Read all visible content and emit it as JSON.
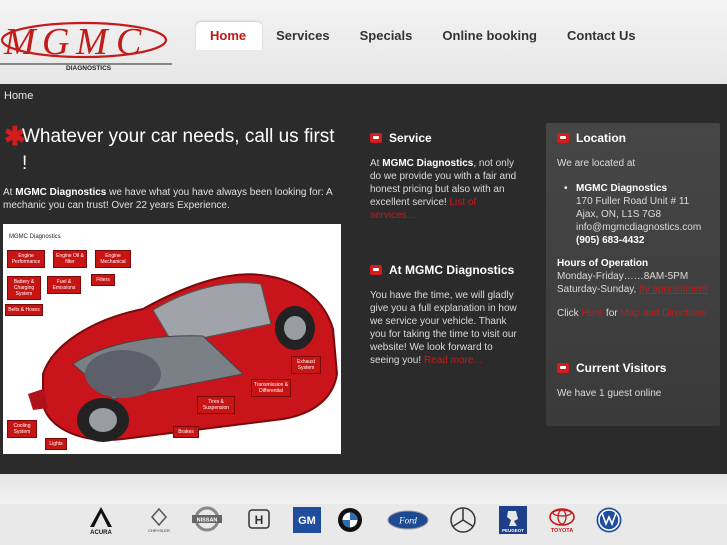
{
  "header": {
    "nav": [
      "Home",
      "Services",
      "Specials",
      "Online booking",
      "Contact Us"
    ],
    "active": "Home"
  },
  "breadcrumb": "Home",
  "main": {
    "headline": "Whatever your car needs, call us first !",
    "intro_pre": "At ",
    "intro_brand": "MGMC Diagnostics",
    "intro_post": " we have what you have always been looking for: A mechanic you can trust! Over 22 years Experience.",
    "diagram": {
      "title": "MGMC Diagnostics",
      "labels": [
        "Engine Performance",
        "Engine Oil & filter",
        "Engine Mechanical",
        "Filters",
        "Battery & Charging System",
        "Fuel & Emissions",
        "Belts & Hoses",
        "Exhaust System",
        "Transmission & Differential",
        "Tires & Suspension",
        "Cooling System",
        "Lights",
        "Brakes"
      ]
    }
  },
  "service": {
    "title": "Service",
    "p1_pre": "At ",
    "p1_brand": "MGMC Diagnostics",
    "p1_post": ", not only do we provide you with a fair and honest pricing but also with an excellent service! ",
    "link": "List of services..."
  },
  "about": {
    "title": "At MGMC Diagnostics",
    "text": "You have the time, we will gladly  give you a full explanation in how we service your vehicle. Thank you for taking the time to visit our website! We look forward to seeing you!",
    "link": "Read more..."
  },
  "location": {
    "title": "Location",
    "located": "We are located at",
    "name": "MGMC Diagnostics",
    "street": "170 Fuller Road Unit # 11",
    "city": "Ajax, ON, L1S 7G8",
    "email": "info@mgmcdiagnostics.com",
    "phone": "(905) 683-4432",
    "hours_title": "Hours of Operation",
    "hours1": "Monday-Friday……8AM-5PM",
    "hours2_pre": "Saturday-Sunday, ",
    "hours2_link": "by appointment",
    "click": "Click ",
    "here": "Here",
    "for": " for ",
    "map": "Map and Directions"
  },
  "visitors": {
    "title": "Current Visitors",
    "text": "We have 1 guest online"
  },
  "brands": [
    "ACURA",
    "CHRYSLER",
    "NISSAN",
    "HONDA",
    "GM",
    "BMW",
    "Ford",
    "Mercedes-Benz",
    "PEUGEOT",
    "TOYOTA",
    "Volkswagen"
  ],
  "colors": {
    "accent": "#d41c1c",
    "dark": "#2b2b2b"
  }
}
